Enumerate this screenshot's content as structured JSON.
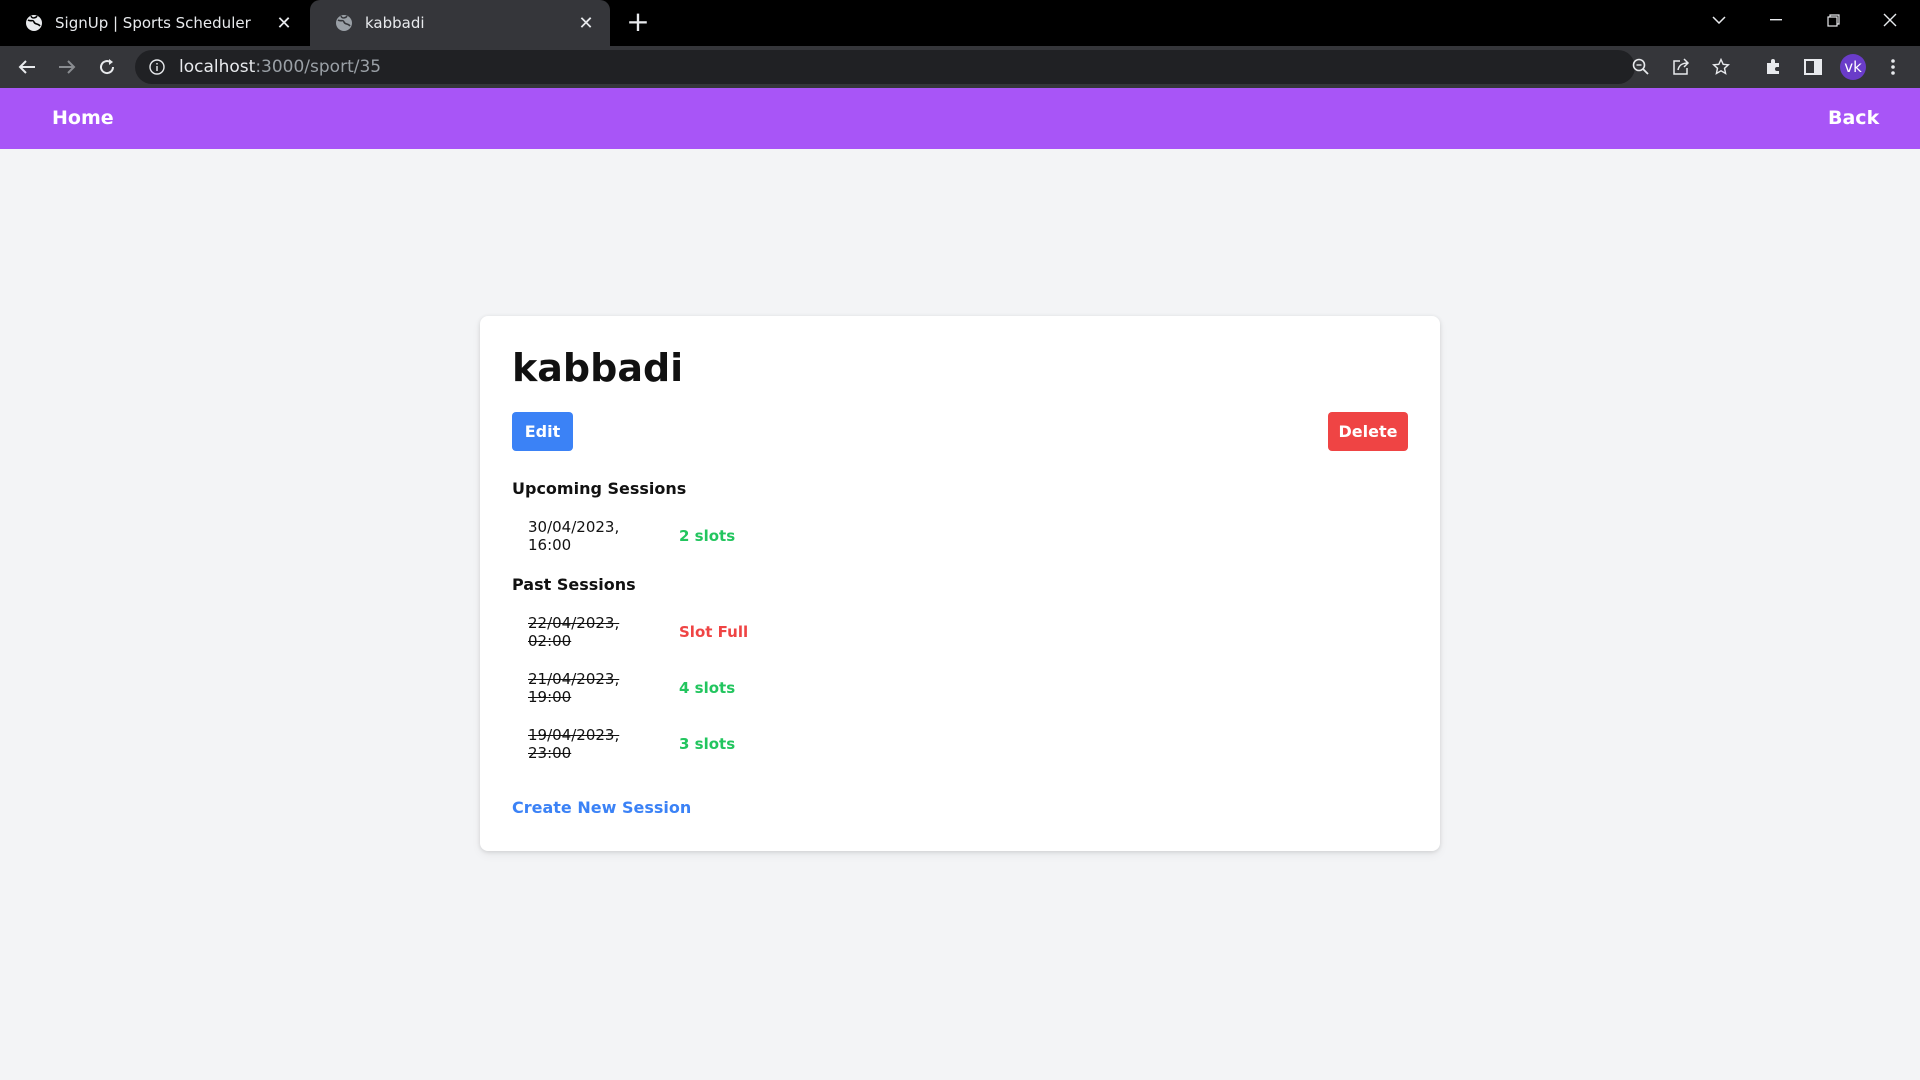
{
  "browser": {
    "tabs": [
      {
        "title": "SignUp | Sports Scheduler",
        "active": false
      },
      {
        "title": "kabbadi",
        "active": true
      }
    ],
    "url_host": "localhost",
    "url_rest": ":3000/sport/35",
    "profile_initials": "vk"
  },
  "nav": {
    "home": "Home",
    "back": "Back"
  },
  "sport": {
    "name": "kabbadi",
    "edit_label": "Edit",
    "delete_label": "Delete",
    "upcoming_heading": "Upcoming Sessions",
    "upcoming": [
      {
        "datetime": "30/04/2023, 16:00",
        "slots": "2 slots",
        "status": "available"
      }
    ],
    "past_heading": "Past Sessions",
    "past": [
      {
        "datetime": "22/04/2023, 02:00",
        "slots": "Slot Full",
        "status": "full"
      },
      {
        "datetime": "21/04/2023, 19:00",
        "slots": "4 slots",
        "status": "available"
      },
      {
        "datetime": "19/04/2023, 23:00",
        "slots": "3 slots",
        "status": "available"
      }
    ],
    "create_label": "Create New Session"
  },
  "colors": {
    "nav_bg": "#a855f7",
    "edit_bg": "#3b82f6",
    "delete_bg": "#ef4444",
    "slots_available": "#22c55e",
    "slots_full": "#ef4444",
    "link": "#3b82f6",
    "page_bg": "#f3f4f6"
  }
}
